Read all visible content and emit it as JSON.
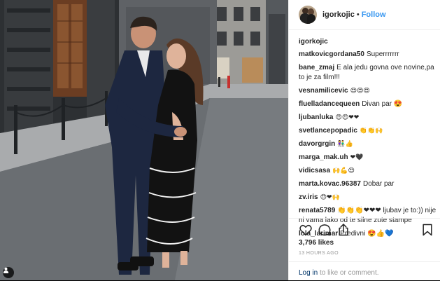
{
  "header": {
    "username": "igorkojic",
    "separator": "•",
    "follow_label": "Follow"
  },
  "caption": {
    "username": "igorkojic"
  },
  "comments": [
    {
      "user": "matkovicgordana50",
      "text": "Superrrrrrr"
    },
    {
      "user": "bane_zmaj",
      "text": "E ala jedu govna ove novine,pa to je za film!!!"
    },
    {
      "user": "vesnamilicevic",
      "text": "😍😍😍"
    },
    {
      "user": "fluelladancequeen",
      "text": "Divan par 😍"
    },
    {
      "user": "ljubanluka",
      "text": "😍😍❤❤"
    },
    {
      "user": "svetlancepopadic",
      "text": "👏👏🙌"
    },
    {
      "user": "davorgrgin",
      "text": "👫👍"
    },
    {
      "user": "marga_mak.uh",
      "text": "❤🖤"
    },
    {
      "user": "vidicsasa",
      "text": "🙌💪😍"
    },
    {
      "user": "marta.kovac.96387",
      "text": "Dobar par"
    },
    {
      "user": "zv.iris",
      "text": "😍❤🙌"
    },
    {
      "user": "renata5789",
      "text": "👏👏👏❤❤❤ ljubav je to:)) nije ni vama lako od te silne zute stampe"
    },
    {
      "user": "lola_larimar",
      "text": "Predivni 😍👍💙"
    }
  ],
  "actions": {
    "icons": [
      "heart-icon",
      "comment-icon",
      "share-icon",
      "bookmark-icon"
    ],
    "likes": "3,796 likes",
    "timestamp": "13 HOURS AGO"
  },
  "login": {
    "link_text": "Log in",
    "rest_text": " to like or comment."
  },
  "colors": {
    "accent": "#3897f0",
    "text": "#262626",
    "muted": "#999999",
    "link": "#003569"
  }
}
